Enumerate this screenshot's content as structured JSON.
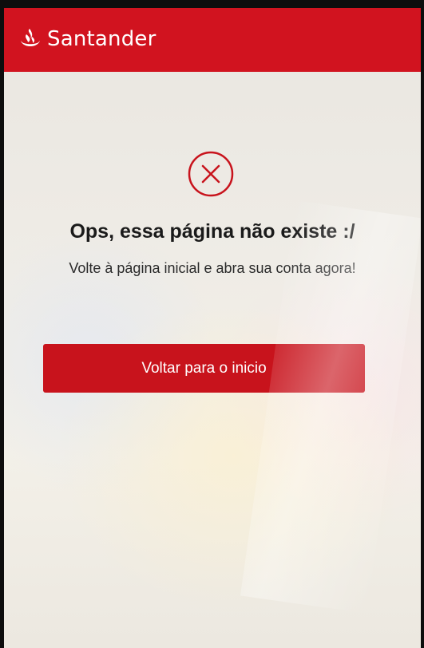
{
  "header": {
    "brand": "Santander",
    "logo_icon": "santander-flame-icon",
    "color": "#d1131f"
  },
  "error": {
    "icon": "close-circle-icon",
    "title": "Ops, essa página não existe :/",
    "message": "Volte à página inicial e abra sua conta agora!"
  },
  "actions": {
    "back_button_label": "Voltar para o inicio"
  },
  "colors": {
    "accent": "#c8131c",
    "text": "#1a1a1a"
  }
}
